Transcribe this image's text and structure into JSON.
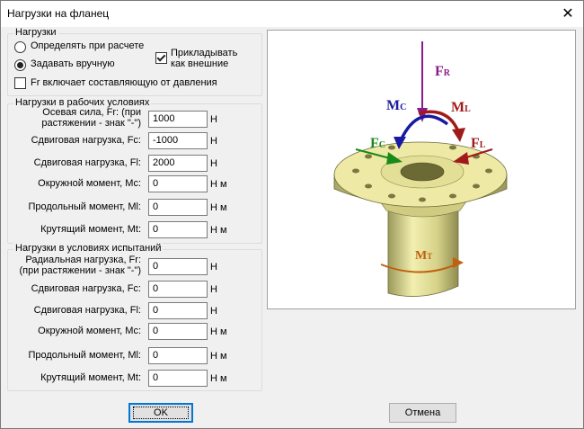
{
  "window": {
    "title": "Нагрузки на фланец"
  },
  "mode_group": {
    "legend": "Нагрузки",
    "radio_calc": "Определять при расчете",
    "radio_manual": "Задавать вручную",
    "apply_external": "Прикладывать\nкак внешние",
    "fr_pressure": "Fr включает составляющую от давления"
  },
  "operating": {
    "legend": "Нагрузки в рабочих условиях",
    "rows": [
      {
        "label": "Осевая сила, Fr: (при\nрастяжении - знак \"-\")",
        "value": "1000",
        "unit": "Н"
      },
      {
        "label": "Сдвиговая нагрузка, Fc:",
        "value": "-1000",
        "unit": "Н"
      },
      {
        "label": "Сдвиговая нагрузка, Fl:",
        "value": "2000",
        "unit": "Н"
      },
      {
        "label": "Окружной момент, Mc:",
        "value": "0",
        "unit": "Н м"
      },
      {
        "label": "Продольный момент, Ml:",
        "value": "0",
        "unit": "Н м"
      },
      {
        "label": "Крутящий момент, Mt:",
        "value": "0",
        "unit": "Н м"
      }
    ]
  },
  "test": {
    "legend": "Нагрузки в условиях испытаний",
    "rows": [
      {
        "label": "Радиальная нагрузка, Fr:\n(при растяжении - знак \"-\")",
        "value": "0",
        "unit": "Н"
      },
      {
        "label": "Сдвиговая нагрузка, Fc:",
        "value": "0",
        "unit": "Н"
      },
      {
        "label": "Сдвиговая нагрузка, Fl:",
        "value": "0",
        "unit": "Н"
      },
      {
        "label": "Окружной момент, Mc:",
        "value": "0",
        "unit": "Н м"
      },
      {
        "label": "Продольный момент, Ml:",
        "value": "0",
        "unit": "Н м"
      },
      {
        "label": "Крутящий момент, Mt:",
        "value": "0",
        "unit": "Н м"
      }
    ]
  },
  "diagram": {
    "fr": "F",
    "fr_sub": "R",
    "mc": "M",
    "mc_sub": "C",
    "ml": "M",
    "ml_sub": "L",
    "fc": "F",
    "fc_sub": "C",
    "fl": "F",
    "fl_sub": "L",
    "mt": "M",
    "mt_sub": "T",
    "colors": {
      "fr": "#8a1a8a",
      "mc": "#1a1aa0",
      "ml": "#a01a1a",
      "fc": "#1a8a1a",
      "fl": "#a01a1a",
      "mt": "#c06010",
      "flange": "#e8e49a"
    }
  },
  "buttons": {
    "ok": "OK",
    "cancel": "Отмена"
  }
}
